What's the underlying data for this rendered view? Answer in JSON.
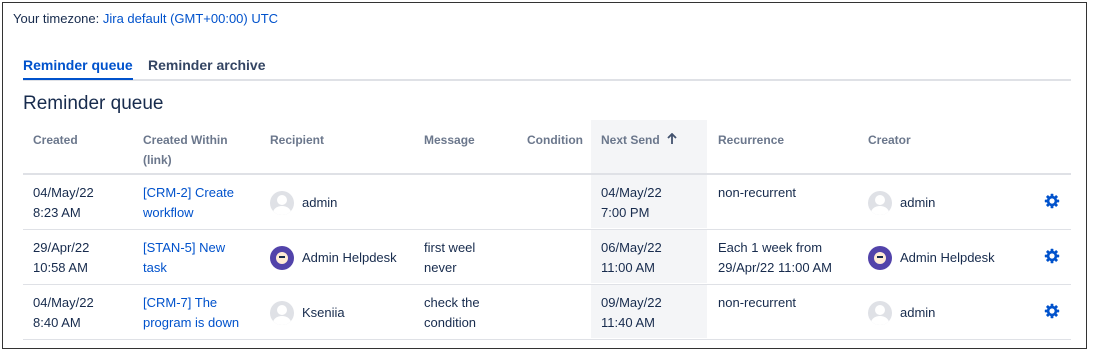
{
  "timezone": {
    "label": "Your timezone:",
    "value": "Jira default (GMT+00:00) UTC"
  },
  "tabs": [
    {
      "label": "Reminder queue"
    },
    {
      "label": "Reminder archive"
    }
  ],
  "section_title": "Reminder queue",
  "columns": {
    "created": "Created",
    "created_within_1": "Created Within",
    "created_within_2": "(link)",
    "recipient": "Recipient",
    "message": "Message",
    "condition": "Condition",
    "next_send": "Next Send",
    "sort_icon": "arrow-up-icon",
    "recurrence": "Recurrence",
    "creator": "Creator"
  },
  "rows": [
    {
      "created_1": "04/May/22",
      "created_2": "8:23 AM",
      "link_1": "[CRM-2] Create",
      "link_2": "workflow",
      "recipient": "admin",
      "recipient_avatar": "default-avatar-icon",
      "message_1": "",
      "message_2": "",
      "condition": "",
      "next_1": "04/May/22",
      "next_2": "7:00 PM",
      "rec_1": "non-recurrent",
      "rec_2": "",
      "creator": "admin",
      "creator_avatar": "default-avatar-icon"
    },
    {
      "created_1": "29/Apr/22",
      "created_2": "10:58 AM",
      "link_1": "[STAN-5] New",
      "link_2": "task",
      "recipient": "Admin Helpdesk",
      "recipient_avatar": "helpdesk-avatar-icon",
      "message_1": "first weel",
      "message_2": "never",
      "condition": "",
      "next_1": "06/May/22",
      "next_2": "11:00 AM",
      "rec_1": "Each 1 week from",
      "rec_2": "29/Apr/22 11:00 AM",
      "creator": "Admin Helpdesk",
      "creator_avatar": "helpdesk-avatar-icon"
    },
    {
      "created_1": "04/May/22",
      "created_2": "8:40 AM",
      "link_1": "[CRM-7] The",
      "link_2": "program is down",
      "recipient": "Kseniia",
      "recipient_avatar": "default-avatar-icon",
      "message_1": "check the",
      "message_2": "condition",
      "condition": "",
      "next_1": "09/May/22",
      "next_2": "11:40 AM",
      "rec_1": "non-recurrent",
      "rec_2": "",
      "creator": "admin",
      "creator_avatar": "default-avatar-icon"
    }
  ],
  "colors": {
    "link": "#0052cc",
    "gear": "#0052cc",
    "sorted_col_bg": "#f4f5f7"
  }
}
